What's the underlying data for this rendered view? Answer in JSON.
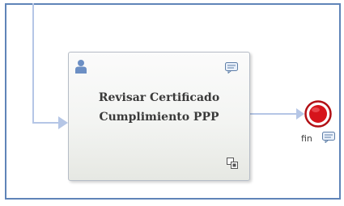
{
  "diagram": {
    "task": {
      "title_line1": "Revisar Certificado",
      "title_line2": "Cumplimiento PPP",
      "icons": [
        "user-icon",
        "comment-icon",
        "subprocess-icon"
      ]
    },
    "end_event": {
      "label": "fin",
      "icons": [
        "end-circle-icon",
        "comment-icon"
      ]
    },
    "colors": {
      "frame": "#5f84b8",
      "connector": "#b5c6e6",
      "end_event_fill": "#d6141b",
      "user_icon": "#6c8fc4"
    }
  }
}
